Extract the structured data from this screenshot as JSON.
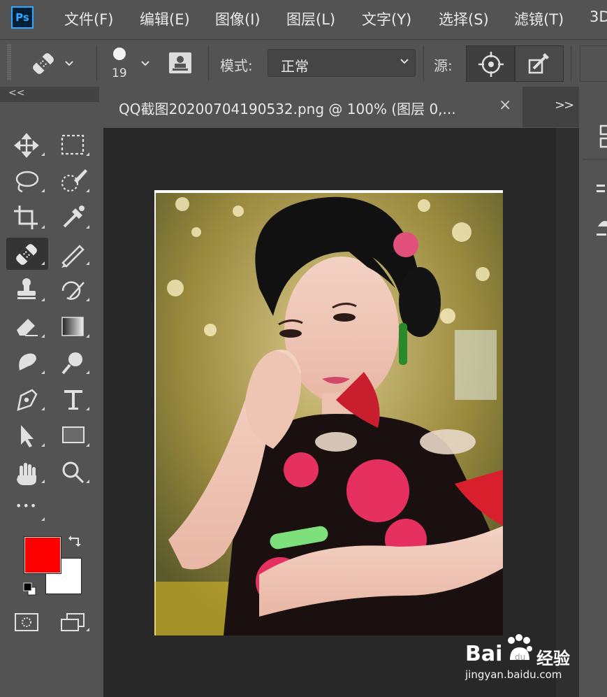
{
  "app": {
    "logo_text": "Ps"
  },
  "menu": {
    "items": [
      "文件(F)",
      "编辑(E)",
      "图像(I)",
      "图层(L)",
      "文字(Y)",
      "选择(S)",
      "滤镜(T)",
      "3D"
    ]
  },
  "options": {
    "brush_size": "19",
    "mode_label": "模式:",
    "mode_value": "正常",
    "source_label": "源:"
  },
  "document": {
    "tab_title": "QQ截图20200704190532.png @ 100% (图层 0,...",
    "close_glyph": "×",
    "panel_expand_glyph": ">>",
    "collapse_left_glyph": "<<"
  },
  "tools": {
    "more_glyph": "•••",
    "active_tool": "spot-healing-brush"
  },
  "colors": {
    "foreground": "#ff0000",
    "background": "#ffffff",
    "accent": "#31a8ff"
  },
  "watermark": {
    "brand_a": "Bai",
    "brand_b": "经验",
    "url": "jingyan.baidu.com"
  }
}
